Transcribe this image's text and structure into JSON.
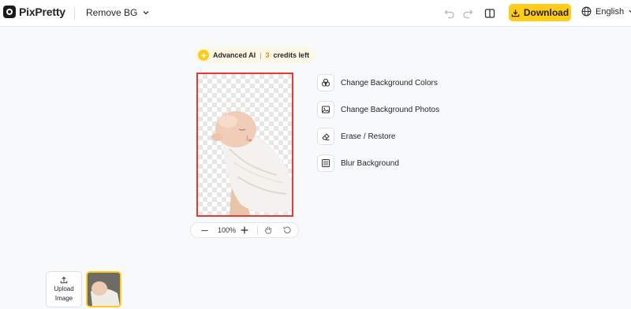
{
  "header": {
    "logo_text": "PixPretty",
    "tool_name": "Remove BG",
    "download_label": "Download",
    "language": "English"
  },
  "credits": {
    "prefix": "Advanced AI",
    "separator": "|",
    "count": "3",
    "suffix": "credits left"
  },
  "zoom": {
    "level": "100%"
  },
  "options": [
    {
      "label": "Change Background Colors",
      "icon": "palette-icon"
    },
    {
      "label": "Change Background Photos",
      "icon": "image-icon"
    },
    {
      "label": "Erase / Restore",
      "icon": "eraser-icon"
    },
    {
      "label": "Blur Background",
      "icon": "blur-grid-icon"
    }
  ],
  "upload": {
    "line1": "Upload",
    "line2": "Image"
  },
  "colors": {
    "accent": "#ffcc1a",
    "canvas_border": "#e53935",
    "credits_number": "#f08c00"
  }
}
